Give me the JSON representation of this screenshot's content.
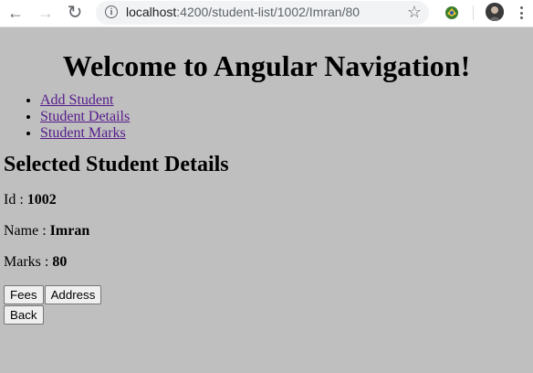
{
  "browser": {
    "url_host": "localhost",
    "url_path": ":4200/student-list/1002/Imran/80",
    "back_icon": "←",
    "forward_icon": "→",
    "reload_icon": "↻",
    "info_icon": "i",
    "star_icon": "☆"
  },
  "page": {
    "title": "Welcome to Angular Navigation!",
    "nav_links": [
      {
        "label": "Add Student"
      },
      {
        "label": "Student Details"
      },
      {
        "label": "Student Marks"
      }
    ],
    "section_title": "Selected Student Details",
    "fields": {
      "id_label": "Id : ",
      "id_value": "1002",
      "name_label": "Name : ",
      "name_value": "Imran",
      "marks_label": "Marks : ",
      "marks_value": "80"
    },
    "buttons": {
      "fees": "Fees",
      "address": "Address",
      "back": "Back"
    }
  },
  "colors": {
    "page_background": "#bfbfbf",
    "link": "#551a8b"
  }
}
